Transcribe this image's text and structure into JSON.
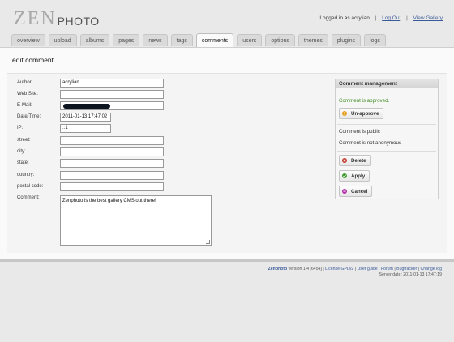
{
  "header": {
    "logo_zen": "ZEN",
    "logo_photo": "PHOTO",
    "logged_in": "Logged in as acrylian",
    "logout": "Log Out",
    "view_gallery": "View Gallery",
    "sep": "|"
  },
  "tabs": [
    {
      "label": "overview"
    },
    {
      "label": "upload"
    },
    {
      "label": "albums"
    },
    {
      "label": "pages"
    },
    {
      "label": "news"
    },
    {
      "label": "tags"
    },
    {
      "label": "comments",
      "active": true
    },
    {
      "label": "users"
    },
    {
      "label": "options"
    },
    {
      "label": "themes"
    },
    {
      "label": "plugins"
    },
    {
      "label": "logs"
    }
  ],
  "page_title": "edit comment",
  "form": {
    "author_label": "Author:",
    "author_value": "acrylian",
    "website_label": "Web Site:",
    "website_value": "",
    "email_label": "E-Mail:",
    "email_value": "",
    "datetime_label": "Date/Time:",
    "datetime_value": "2011-01-13 17:47:02",
    "ip_label": "IP:",
    "ip_value": "::1",
    "street_label": "street:",
    "street_value": "",
    "city_label": "city:",
    "city_value": "",
    "state_label": "state:",
    "state_value": "",
    "country_label": "country:",
    "country_value": "",
    "postal_label": "postal code:",
    "postal_value": "",
    "comment_label": "Comment:",
    "comment_value": "Zenphoto is the best gallery CMS out there!"
  },
  "management": {
    "title": "Comment management",
    "status": "Comment is approved.",
    "unapprove": "Un-approve",
    "public": "Comment is public",
    "anonymous": "Comment is not anonymous",
    "delete": "Delete",
    "apply": "Apply",
    "cancel": "Cancel"
  },
  "footer": {
    "brand": "Zenphoto",
    "version": " version 1.4 [6454] | ",
    "license": "License:GPLv2",
    "sep1": " | ",
    "user_guide": "User guide",
    "sep2": " | ",
    "forum": "Forum",
    "sep3": " | ",
    "bugtracker": "Bugtracker",
    "sep4": " | ",
    "changelog": "Change log",
    "server_date": "Server date: 2011-01-13 17:47:19"
  },
  "colors": {
    "approved_green": "#3c8a1e",
    "link_blue": "#3a5a9a",
    "unapprove_icon": "#e6a01e",
    "delete_icon": "#c63b2d",
    "apply_icon": "#3e9a2c",
    "cancel_icon": "#b02fa6"
  },
  "icons": {
    "unapprove": "warning-icon",
    "delete": "delete-icon",
    "apply": "check-icon",
    "cancel": "cancel-icon"
  }
}
